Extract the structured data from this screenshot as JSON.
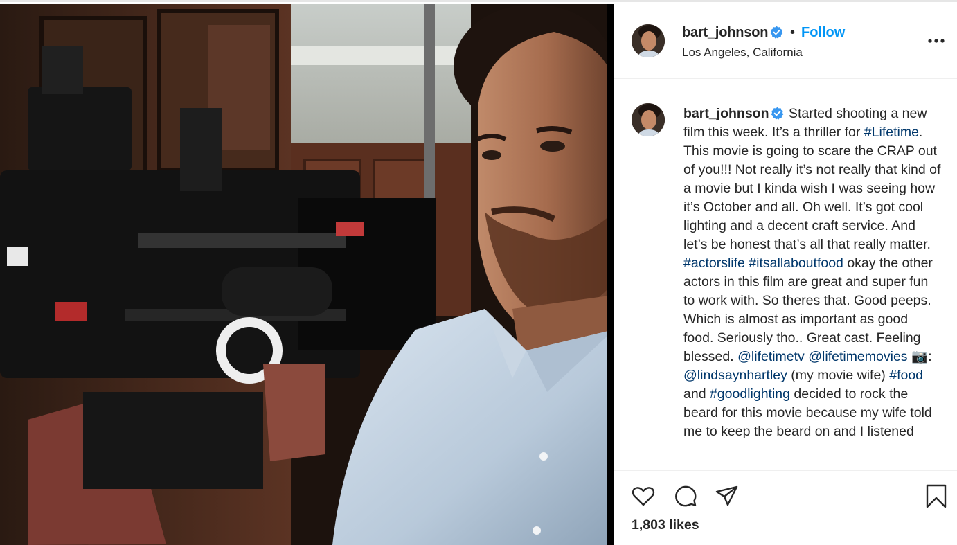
{
  "post": {
    "username": "bart_johnson",
    "separator": "•",
    "follow_label": "Follow",
    "location": "Los Angeles, California",
    "more_icon": "more-horizontal-icon",
    "verified_icon": "verified-badge-icon",
    "accent_color": "#0095f6",
    "hashtag_color": "#00376b"
  },
  "caption": {
    "username": "bart_johnson",
    "segments": [
      {
        "type": "text",
        "value": " Started shooting a new film this week. It’s a thriller for "
      },
      {
        "type": "tag",
        "value": "#Lifetime"
      },
      {
        "type": "text",
        "value": ". This movie is going to scare the CRAP out of you!!! Not really it’s not really that kind of a movie but I kinda wish I was seeing how it’s October and all. Oh well. It’s got cool lighting and a decent craft service. And let’s be honest that’s all that really matter. "
      },
      {
        "type": "tag",
        "value": "#actorslife"
      },
      {
        "type": "text",
        "value": " "
      },
      {
        "type": "tag",
        "value": "#itsallaboutfood"
      },
      {
        "type": "text",
        "value": " okay the other actors in this film are great and super fun to work with. So theres that. Good peeps. Which is almost as important as good food. Seriously tho.. Great cast. Feeling blessed. "
      },
      {
        "type": "tag",
        "value": "@lifetimetv"
      },
      {
        "type": "text",
        "value": " "
      },
      {
        "type": "tag",
        "value": "@lifetimemovies"
      },
      {
        "type": "text",
        "value": " 📷: "
      },
      {
        "type": "tag",
        "value": "@lindsaynhartley"
      },
      {
        "type": "text",
        "value": " (my movie wife) "
      },
      {
        "type": "tag",
        "value": "#food"
      },
      {
        "type": "text",
        "value": " and "
      },
      {
        "type": "tag",
        "value": "#goodlighting"
      },
      {
        "type": "text",
        "value": " decided to rock the beard for this movie because my wife told me to keep the beard on and I listened"
      }
    ]
  },
  "actions": {
    "like_icon": "heart-icon",
    "comment_icon": "comment-bubble-icon",
    "share_icon": "paper-plane-icon",
    "save_icon": "bookmark-icon",
    "likes_text": "1,803 likes"
  }
}
